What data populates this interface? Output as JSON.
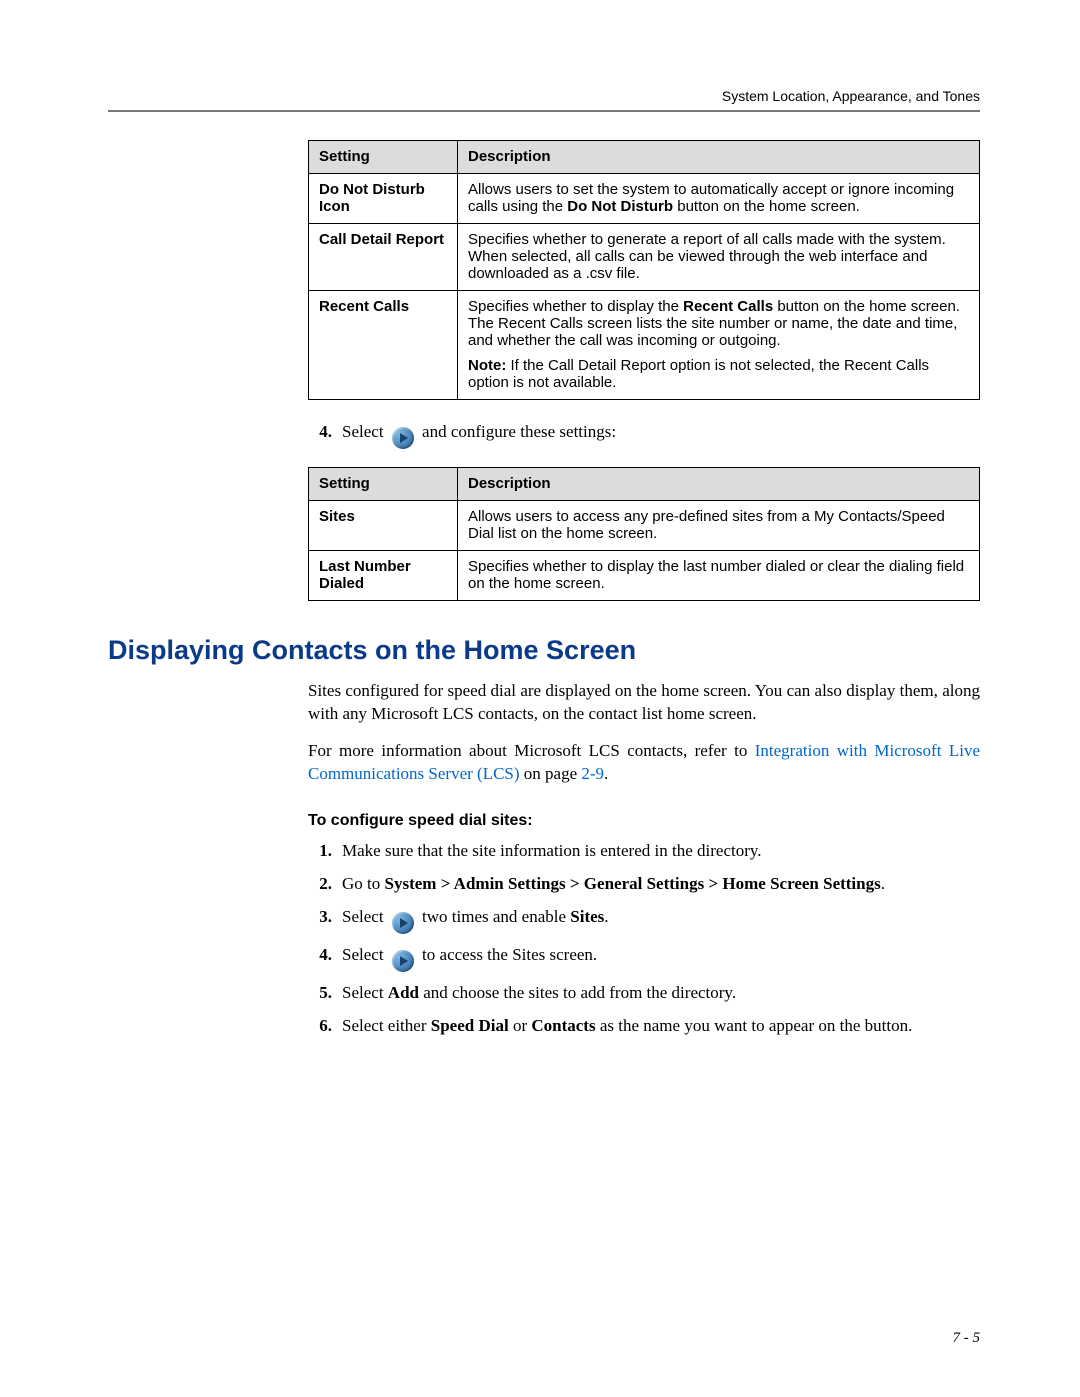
{
  "header": "System Location, Appearance, and Tones",
  "page_number": "7 - 5",
  "table1": {
    "head_setting": "Setting",
    "head_description": "Description",
    "rows": [
      {
        "setting": "Do Not Disturb Icon",
        "desc1_a": "Allows users to set the system to automatically accept or ignore incoming calls using the ",
        "desc1_bold": "Do Not Disturb",
        "desc1_b": " button on the home screen."
      },
      {
        "setting": "Call Detail Report",
        "desc1": "Specifies whether to generate a report of all calls made with the system. When selected, all calls can be viewed through the web interface and downloaded as a .csv file."
      },
      {
        "setting": "Recent Calls",
        "desc1_a": "Specifies whether to display the ",
        "desc1_bold": "Recent Calls",
        "desc1_b": " button on the home screen. The Recent Calls screen lists the site number or name, the date and time, and whether the call was incoming or outgoing.",
        "desc2_bold": "Note:",
        "desc2": " If the Call Detail Report option is not selected, the Recent Calls option is not available."
      }
    ]
  },
  "step4": {
    "number": "4.",
    "before": "Select ",
    "after": " and configure these settings:"
  },
  "table2": {
    "head_setting": "Setting",
    "head_description": "Description",
    "rows": [
      {
        "setting": "Sites",
        "desc": "Allows users to access any pre-defined sites from a My Contacts/Speed Dial list on the home screen."
      },
      {
        "setting": "Last Number Dialed",
        "desc": "Specifies whether to display the last number dialed or clear the dialing field on the home screen."
      }
    ]
  },
  "section_heading": "Displaying Contacts on the Home Screen",
  "para1": "Sites configured for speed dial are displayed on the home screen. You can also display them, along with any Microsoft LCS contacts, on the contact list home screen.",
  "para2_a": "For more information about Microsoft LCS contacts, refer to ",
  "para2_link": "Integration with Microsoft Live Communications Server (LCS)",
  "para2_b": " on page ",
  "para2_page": "2-9",
  "para2_c": ".",
  "subhead": "To configure speed dial sites:",
  "steps": {
    "s1": "Make sure that the site information is entered in the directory.",
    "s2_a": "Go to ",
    "s2_bold": "System > Admin Settings > General Settings > Home Screen Settings",
    "s2_b": ".",
    "s3_a": "Select ",
    "s3_b": " two times and enable ",
    "s3_bold": "Sites",
    "s3_c": ".",
    "s4_a": "Select ",
    "s4_b": " to access the Sites screen.",
    "s5_a": "Select ",
    "s5_bold": "Add",
    "s5_b": " and choose the sites to add from the directory.",
    "s6_a": "Select either ",
    "s6_bold1": "Speed Dial",
    "s6_mid": " or ",
    "s6_bold2": "Contacts",
    "s6_b": " as the name you want to appear on the button."
  }
}
